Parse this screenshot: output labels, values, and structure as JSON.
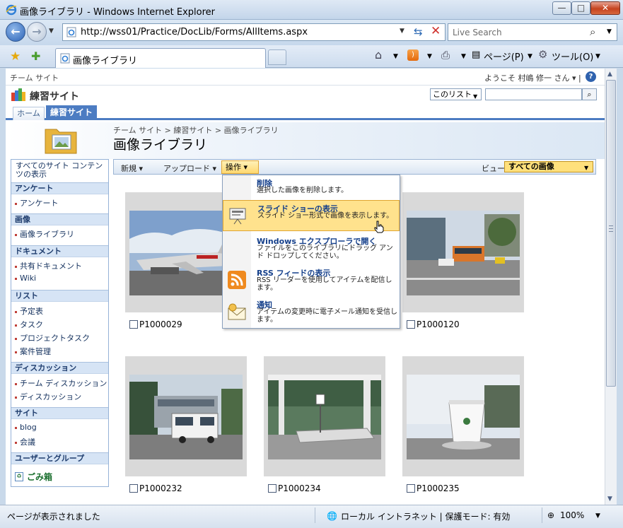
{
  "window": {
    "title": "画像ライブラリ - Windows Internet Explorer",
    "minimize": "—",
    "maximize": "□",
    "close": "✕"
  },
  "addressbar": {
    "url": "http://wss01/Practice/DocLib/Forms/AllItems.aspx",
    "search_placeholder": "Live Search"
  },
  "tabs": [
    {
      "label": "画像ライブラリ"
    }
  ],
  "commandbar": {
    "page": "ページ(P)",
    "tools": "ツール(O)"
  },
  "sharepoint": {
    "top_link": "チーム サイト",
    "welcome": "ようこそ 村嶋 修一 さん ▾ |",
    "site_name": "練習サイト",
    "search_scope": "このリスト",
    "nav_tabs": [
      "ホーム",
      "練習サイト"
    ],
    "breadcrumb": "チーム サイト > 練習サイト > 画像ライブラリ",
    "page_title": "画像ライブラリ"
  },
  "leftnav": {
    "all_sites": "すべてのサイト コンテンツの表示",
    "sections": [
      {
        "head": "アンケート",
        "items": [
          "アンケート"
        ]
      },
      {
        "head": "画像",
        "items": [
          "画像ライブラリ"
        ]
      },
      {
        "head": "ドキュメント",
        "items": [
          "共有ドキュメント",
          "Wiki"
        ]
      },
      {
        "head": "リスト",
        "items": [
          "予定表",
          "タスク",
          "プロジェクトタスク",
          "案件管理"
        ]
      },
      {
        "head": "ディスカッション",
        "items": [
          "チーム ディスカッション",
          "ディスカッション"
        ]
      },
      {
        "head": "サイト",
        "items": [
          "blog",
          "会議"
        ]
      },
      {
        "head": "ユーザーとグループ",
        "items": []
      }
    ],
    "recycle_bin": "ごみ箱"
  },
  "toolbar": {
    "new": "新規 ▾",
    "upload": "アップロード ▾",
    "actions": "操作 ▾",
    "view_label": "ビュー:",
    "view_value": "すべての画像"
  },
  "menu": {
    "items": [
      {
        "title": "削除",
        "desc": "選択した画像を削除します。"
      },
      {
        "title": "スライド ショーの表示",
        "desc": "スライド ショー形式で画像を表示します。"
      },
      {
        "title": "Windows エクスプローラで開く",
        "desc": "ファイルをこのライブラリにドラッグ アンド ドロップしてください。"
      },
      {
        "title": "RSS フィードの表示",
        "desc": "RSS リーダーを使用してアイテムを配信します。"
      },
      {
        "title": "通知",
        "desc": "アイテムの変更時に電子メール通知を受信します。"
      }
    ]
  },
  "images": [
    {
      "name": "P1000029"
    },
    {
      "name": "P1000120"
    },
    {
      "name": "P1000232"
    },
    {
      "name": "P1000234"
    },
    {
      "name": "P1000235"
    }
  ],
  "statusbar": {
    "status": "ページが表示されました",
    "zone": "ローカル イントラネット | 保護モード: 有効",
    "zoom": "100%"
  },
  "colors": {
    "sp_accent": "#4c7cc2",
    "menu_highlight": "#ffe28d"
  }
}
